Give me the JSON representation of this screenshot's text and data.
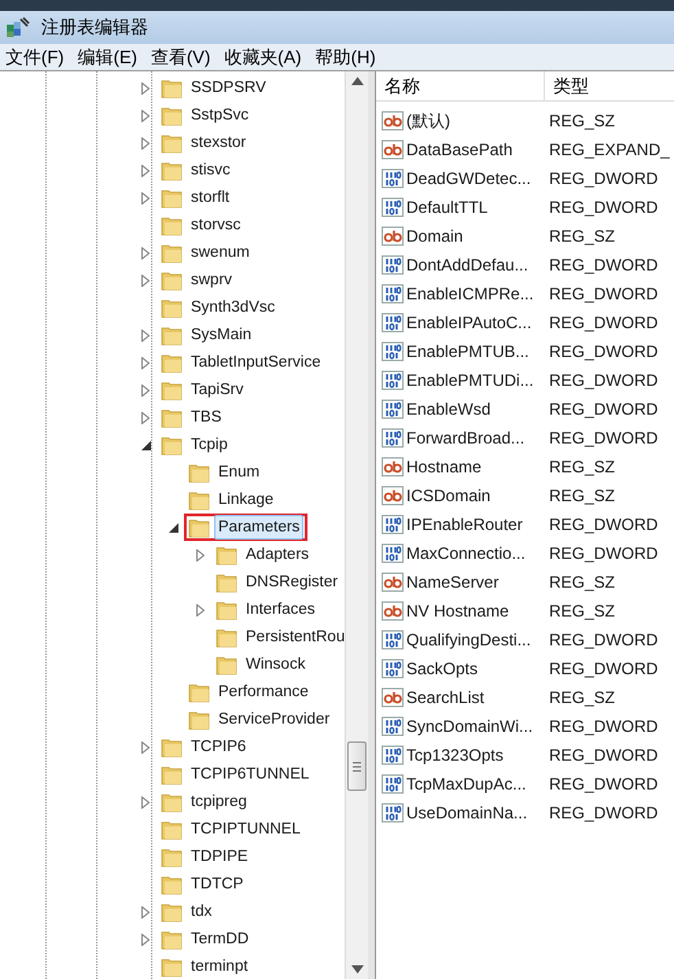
{
  "window": {
    "title": "注册表编辑器"
  },
  "menu": [
    "文件(F)",
    "编辑(E)",
    "查看(V)",
    "收藏夹(A)",
    "帮助(H)"
  ],
  "tree": [
    {
      "label": "SSDPSRV",
      "has_children": true,
      "selected": false,
      "marked": false
    },
    {
      "label": "SstpSvc",
      "has_children": true,
      "selected": false,
      "marked": false
    },
    {
      "label": "stexstor",
      "has_children": true,
      "selected": false,
      "marked": false
    },
    {
      "label": "stisvc",
      "has_children": true,
      "selected": false,
      "marked": false
    },
    {
      "label": "storflt",
      "has_children": true,
      "selected": false,
      "marked": false
    },
    {
      "label": "storvsc",
      "has_children": false,
      "selected": false,
      "marked": false
    },
    {
      "label": "swenum",
      "has_children": true,
      "selected": false,
      "marked": false
    },
    {
      "label": "swprv",
      "has_children": true,
      "selected": false,
      "marked": false
    },
    {
      "label": "Synth3dVsc",
      "has_children": false,
      "selected": false,
      "marked": false
    },
    {
      "label": "SysMain",
      "has_children": true,
      "selected": false,
      "marked": false
    },
    {
      "label": "TabletInputService",
      "has_children": true,
      "selected": false,
      "marked": false
    },
    {
      "label": "TapiSrv",
      "has_children": true,
      "selected": false,
      "marked": false
    },
    {
      "label": "TBS",
      "has_children": true,
      "selected": false,
      "marked": false
    },
    {
      "label": "Tcpip",
      "has_children": true,
      "selected": false,
      "marked": false,
      "children": [
        {
          "label": "Enum",
          "has_children": false,
          "selected": false,
          "marked": false
        },
        {
          "label": "Linkage",
          "has_children": false,
          "selected": false,
          "marked": false
        },
        {
          "label": "Parameters",
          "has_children": true,
          "selected": true,
          "marked": true,
          "children": [
            {
              "label": "Adapters",
              "has_children": true,
              "selected": false,
              "marked": false
            },
            {
              "label": "DNSRegister",
              "has_children": false,
              "selected": false,
              "marked": false
            },
            {
              "label": "Interfaces",
              "has_children": true,
              "selected": false,
              "marked": false
            },
            {
              "label": "PersistentRou",
              "has_children": false,
              "selected": false,
              "marked": false
            },
            {
              "label": "Winsock",
              "has_children": false,
              "selected": false,
              "marked": false
            }
          ]
        },
        {
          "label": "Performance",
          "has_children": false,
          "selected": false,
          "marked": false
        },
        {
          "label": "ServiceProvider",
          "has_children": false,
          "selected": false,
          "marked": false
        }
      ]
    },
    {
      "label": "TCPIP6",
      "has_children": true,
      "selected": false,
      "marked": false
    },
    {
      "label": "TCPIP6TUNNEL",
      "has_children": false,
      "selected": false,
      "marked": false
    },
    {
      "label": "tcpipreg",
      "has_children": true,
      "selected": false,
      "marked": false
    },
    {
      "label": "TCPIPTUNNEL",
      "has_children": false,
      "selected": false,
      "marked": false
    },
    {
      "label": "TDPIPE",
      "has_children": false,
      "selected": false,
      "marked": false
    },
    {
      "label": "TDTCP",
      "has_children": false,
      "selected": false,
      "marked": false
    },
    {
      "label": "tdx",
      "has_children": true,
      "selected": false,
      "marked": false
    },
    {
      "label": "TermDD",
      "has_children": true,
      "selected": false,
      "marked": false
    },
    {
      "label": "terminpt",
      "has_children": false,
      "selected": false,
      "marked": false
    }
  ],
  "values": {
    "columns": [
      "名称",
      "类型"
    ],
    "rows": [
      {
        "kind": "string",
        "name": "(默认)",
        "type": "REG_SZ"
      },
      {
        "kind": "string",
        "name": "DataBasePath",
        "type": "REG_EXPAND_"
      },
      {
        "kind": "binary",
        "name": "DeadGWDetec...",
        "type": "REG_DWORD"
      },
      {
        "kind": "binary",
        "name": "DefaultTTL",
        "type": "REG_DWORD"
      },
      {
        "kind": "string",
        "name": "Domain",
        "type": "REG_SZ"
      },
      {
        "kind": "binary",
        "name": "DontAddDefau...",
        "type": "REG_DWORD"
      },
      {
        "kind": "binary",
        "name": "EnableICMPRe...",
        "type": "REG_DWORD"
      },
      {
        "kind": "binary",
        "name": "EnableIPAutoC...",
        "type": "REG_DWORD"
      },
      {
        "kind": "binary",
        "name": "EnablePMTUB...",
        "type": "REG_DWORD"
      },
      {
        "kind": "binary",
        "name": "EnablePMTUDi...",
        "type": "REG_DWORD"
      },
      {
        "kind": "binary",
        "name": "EnableWsd",
        "type": "REG_DWORD"
      },
      {
        "kind": "binary",
        "name": "ForwardBroad...",
        "type": "REG_DWORD"
      },
      {
        "kind": "string",
        "name": "Hostname",
        "type": "REG_SZ"
      },
      {
        "kind": "string",
        "name": "ICSDomain",
        "type": "REG_SZ"
      },
      {
        "kind": "binary",
        "name": "IPEnableRouter",
        "type": "REG_DWORD"
      },
      {
        "kind": "binary",
        "name": "MaxConnectio...",
        "type": "REG_DWORD"
      },
      {
        "kind": "string",
        "name": "NameServer",
        "type": "REG_SZ"
      },
      {
        "kind": "string",
        "name": "NV Hostname",
        "type": "REG_SZ"
      },
      {
        "kind": "binary",
        "name": "QualifyingDesti...",
        "type": "REG_DWORD"
      },
      {
        "kind": "binary",
        "name": "SackOpts",
        "type": "REG_DWORD"
      },
      {
        "kind": "string",
        "name": "SearchList",
        "type": "REG_SZ"
      },
      {
        "kind": "binary",
        "name": "SyncDomainWi...",
        "type": "REG_DWORD"
      },
      {
        "kind": "binary",
        "name": "Tcp1323Opts",
        "type": "REG_DWORD"
      },
      {
        "kind": "binary",
        "name": "TcpMaxDupAc...",
        "type": "REG_DWORD"
      },
      {
        "kind": "binary",
        "name": "UseDomainNa...",
        "type": "REG_DWORD"
      }
    ]
  }
}
